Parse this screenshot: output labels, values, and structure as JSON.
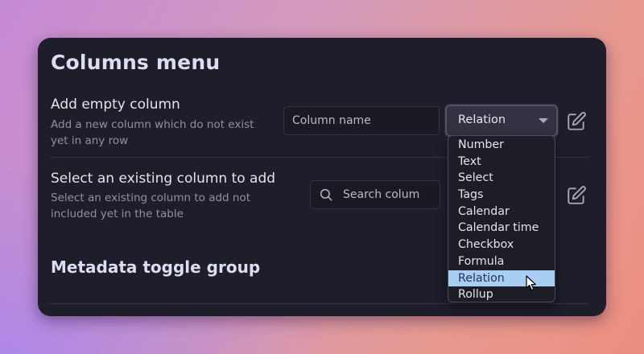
{
  "panel": {
    "title": "Columns menu",
    "add_empty": {
      "title": "Add empty column",
      "description": "Add a new column which do not exist yet in any row",
      "input_placeholder": "Column name",
      "select_value": "Relation"
    },
    "select_existing": {
      "title": "Select an existing column to add",
      "description": "Select an existing column to add not included yet in the table",
      "search_placeholder": "Search colum"
    },
    "metadata_title": "Metadata toggle group"
  },
  "dropdown": {
    "options": [
      "Number",
      "Text",
      "Select",
      "Tags",
      "Calendar",
      "Calendar time",
      "Checkbox",
      "Formula",
      "Relation",
      "Rollup"
    ],
    "selected": "Relation"
  },
  "icons": {
    "edit": "pencil-square-icon",
    "search": "search-icon",
    "caret": "chevron-down-icon",
    "cursor": "mouse-pointer-icon"
  },
  "colors": {
    "panel_bg": "#1e1e2a",
    "selected_option_bg": "#a8cef4",
    "muted_text": "#8f90a2"
  }
}
